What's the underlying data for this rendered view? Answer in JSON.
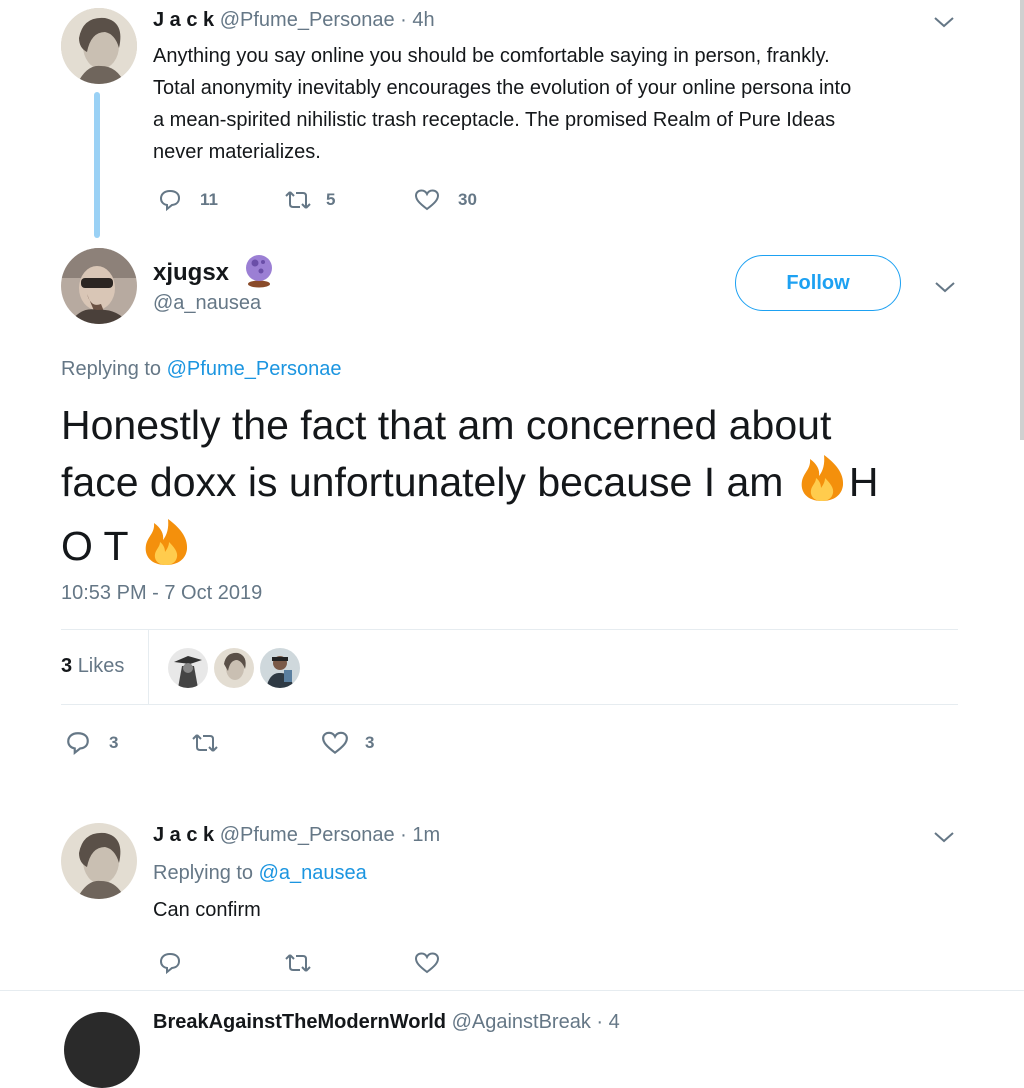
{
  "tweet1": {
    "name": "J a c k",
    "handle": "@Pfume_Personae",
    "time": "· 4h",
    "text_lines": [
      "Anything you say online you should be comfortable saying in person, frankly.",
      "Total anonymity inevitably encourages the evolution of your online persona into",
      "a mean-spirited nihilistic trash receptacle. The promised Realm of Pure Ideas",
      "never materializes."
    ],
    "replies": "11",
    "retweets": "5",
    "likes": "30"
  },
  "main_tweet": {
    "name": "xjugsx",
    "handle": "@a_nausea",
    "follow_label": "Follow",
    "replying_prefix": "Replying to",
    "replying_handle": "@Pfume_Personae",
    "text_line1": "Honestly the fact that am concerned about",
    "text_line2a": "face doxx is unfortunately because I am ",
    "text_line2b": "H",
    "text_line3": "O T ",
    "timestamp": "10:53 PM - 7 Oct 2019",
    "likes_count": "3",
    "likes_label": "Likes",
    "replies": "3",
    "likes": "3"
  },
  "reply_tweet": {
    "name": "J a c k",
    "handle": "@Pfume_Personae",
    "time": "· 1m",
    "replying_prefix": "Replying to",
    "replying_handle": "@a_nausea",
    "text": "Can confirm"
  },
  "next_tweet": {
    "name_fragment": "BreakAgainstTheModernWorld",
    "handle_fragment": "@AgainstBreak · 4"
  },
  "colors": {
    "accent": "#1da1f2",
    "link": "#1b95e0",
    "muted": "#657786",
    "thread_line": "#9ad1f5"
  },
  "icons": [
    "reply-icon",
    "retweet-icon",
    "like-icon",
    "chevron-down-icon",
    "crystal-ball-emoji",
    "fire-emoji"
  ]
}
